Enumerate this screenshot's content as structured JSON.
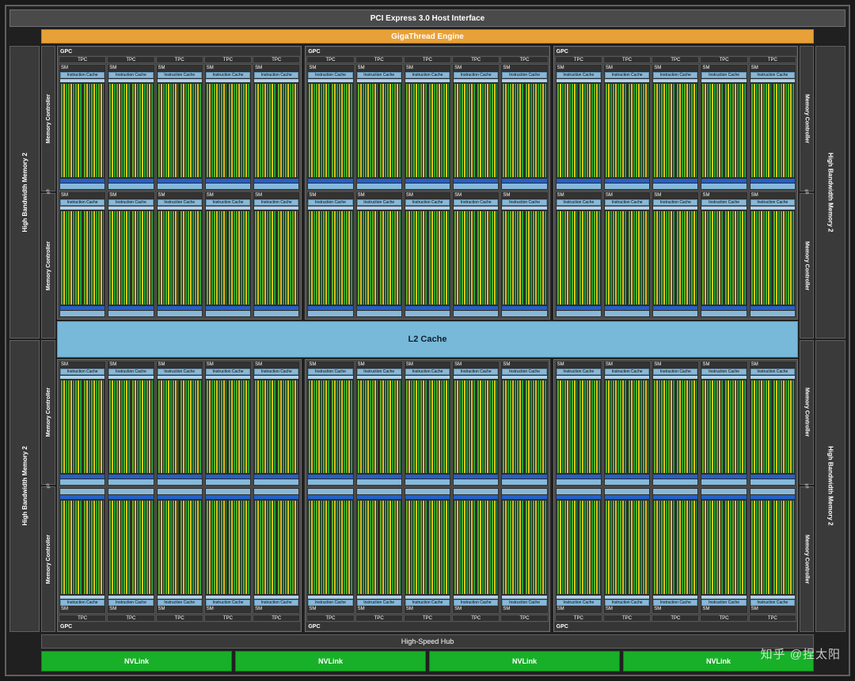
{
  "top_bar": "PCI Express 3.0 Host Interface",
  "giga": "GigaThread Engine",
  "hbm": "High Bandwidth Memory 2",
  "memctrl": "Memory Controller",
  "gpc": "GPC",
  "tpc": "TPC",
  "sm": "SM",
  "icache": "Instruction Cache",
  "l2": "L2 Cache",
  "hub": "High-Speed Hub",
  "nvlink": "NVLink",
  "watermark": "知乎 @捏太阳",
  "counts": {
    "gpc_rows_top": 1,
    "gpc_rows_bottom": 1,
    "gpcs_per_row": 3,
    "sm_rows_per_gpc": 2,
    "sms_per_row": 5,
    "tpcs_per_gpc_row": 5,
    "nvlinks": 4,
    "memctrl_per_side": 4,
    "hbm_per_side": 2
  },
  "colors": {
    "accent_orange": "#e8a038",
    "cache_blue": "#88b8d8",
    "l2_blue": "#78b8d8",
    "nvlink_green": "#18b028",
    "core_green": "#58b020",
    "core_yellow": "#e8c020",
    "ldst_blue": "#2560c8"
  }
}
